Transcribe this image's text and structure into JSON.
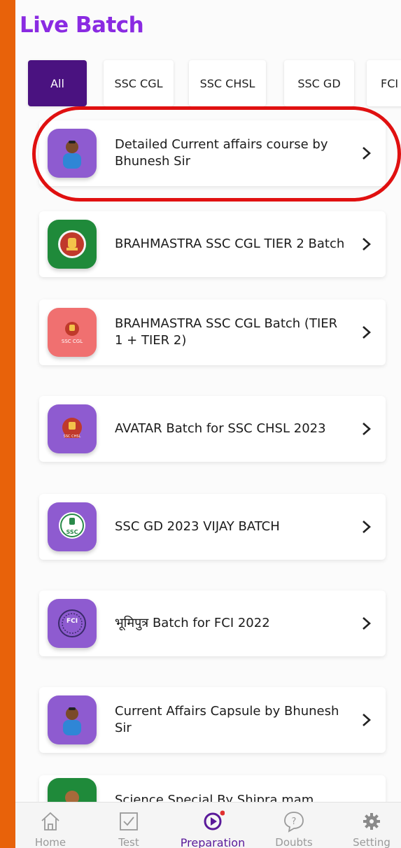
{
  "header": {
    "title": "Live Batch"
  },
  "filters": [
    {
      "label": "All",
      "active": true
    },
    {
      "label": "SSC CGL",
      "active": false
    },
    {
      "label": "SSC CHSL",
      "active": false
    },
    {
      "label": "SSC GD",
      "active": false
    },
    {
      "label": "FCI",
      "active": false
    }
  ],
  "batches": [
    {
      "title": "Detailed Current affairs course by Bhunesh Sir",
      "icon": "teacher-avatar-icon",
      "icon_bg": "#8e5bd0",
      "highlighted": true
    },
    {
      "title": "BRAHMASTRA SSC CGL TIER 2 Batch",
      "icon": "ssc-emblem-icon",
      "icon_bg": "#1f8a3a"
    },
    {
      "title": "BRAHMASTRA SSC CGL Batch (TIER 1 + TIER 2)",
      "icon": "ssc-cgl-emblem-icon",
      "icon_bg": "#f07070",
      "icon_text": "SSC CGL"
    },
    {
      "title": "AVATAR Batch  for SSC CHSL 2023",
      "icon": "ssc-chsl-emblem-icon",
      "icon_bg": "#8e5bd0",
      "icon_text": "SSC CHSL"
    },
    {
      "title": "SSC GD 2023 VIJAY BATCH",
      "icon": "ssc-gd-emblem-icon",
      "icon_bg": "#8e5bd0",
      "icon_text": "SSC"
    },
    {
      "title": "भूमिपुत्र Batch for FCI 2022",
      "icon": "fci-emblem-icon",
      "icon_bg": "#8e5bd0",
      "icon_text": "FCI"
    },
    {
      "title": "Current Affairs Capsule by Bhunesh Sir",
      "icon": "teacher-avatar-icon",
      "icon_bg": "#8e5bd0"
    },
    {
      "title": "Science Special By Shipra mam",
      "icon": "teacher-avatar-icon",
      "icon_bg": "#1f8a3a"
    }
  ],
  "bottom_nav": [
    {
      "label": "Home",
      "icon": "home-icon"
    },
    {
      "label": "Test",
      "icon": "checkbox-icon"
    },
    {
      "label": "Preparation",
      "icon": "play-circle-icon",
      "active": true
    },
    {
      "label": "Doubts",
      "icon": "question-bubble-icon"
    },
    {
      "label": "Setting",
      "icon": "gear-icon"
    }
  ],
  "colors": {
    "accent": "#8a2be2",
    "active_chip": "#4a1280",
    "nav_active": "#5a1a9a",
    "highlight_ring": "#e01010",
    "side_bar": "#e8620a",
    "notification_dot": "#e03030"
  }
}
